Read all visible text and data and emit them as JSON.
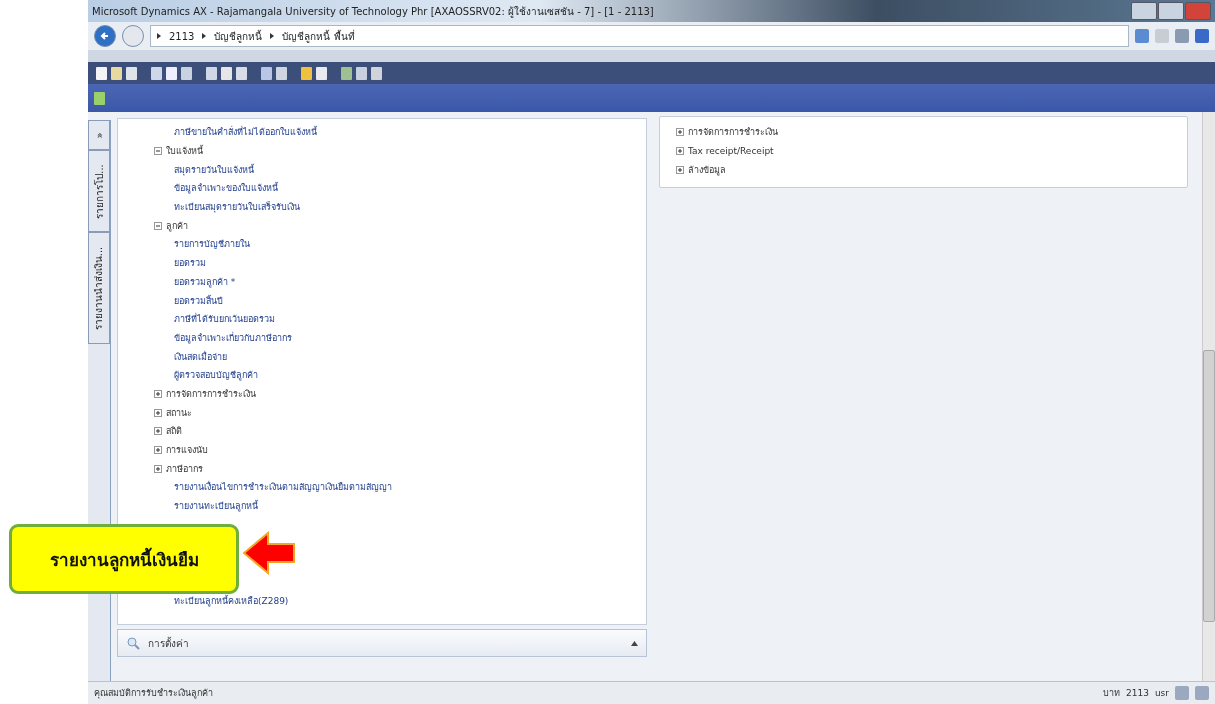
{
  "window": {
    "title": "Microsoft Dynamics AX - Rajamangala University of Technology Phr [AXAOSSRV02: ผู้ใช้งานเซสชัน - 7] - [1 - 2113]"
  },
  "address_bar": {
    "crumbs": [
      "2113",
      "บัญชีลูกหนี้",
      "บัญชีลูกหนี้ พื้นที่"
    ]
  },
  "side_tabs": [
    {
      "label": "»"
    },
    {
      "label": "รายการโป..."
    },
    {
      "label": "รายงานนำส่งเงิน..."
    }
  ],
  "tree": [
    {
      "label": "ภาษีขายในคำสั่งที่ไม่ได้ออกใบแจ้งหนี้"
    },
    {
      "label": "ใบแจ้งหนี้",
      "expanded": true,
      "children": [
        {
          "label": "สมุดรายวันใบแจ้งหนี้"
        },
        {
          "label": "ข้อมูลจำเพาะของใบแจ้งหนี้"
        },
        {
          "label": "ทะเบียนสมุดรายวันใบเสร็จรับเงิน"
        }
      ]
    },
    {
      "label": "ลูกค้า",
      "expanded": true,
      "children": [
        {
          "label": "รายการบัญชีภายใน"
        },
        {
          "label": "ยอดรวม"
        },
        {
          "label": "ยอดรวมลูกค้า *"
        },
        {
          "label": "ยอดรวมสิ้นปี"
        },
        {
          "label": "ภาษีที่ได้รับยกเว้นยอดรวม"
        },
        {
          "label": "ข้อมูลจำเพาะเกี่ยวกับภาษีอากร"
        },
        {
          "label": "เงินสดเมื่อจ่าย"
        },
        {
          "label": "ผู้ตรวจสอบบัญชีลูกค้า"
        }
      ]
    },
    {
      "label": "การจัดการการชำระเงิน",
      "expanded": false
    },
    {
      "label": "สถานะ",
      "expanded": false
    },
    {
      "label": "สถิติ",
      "expanded": false
    },
    {
      "label": "การแจงนับ",
      "expanded": false
    },
    {
      "label": "ภาษีอากร",
      "expanded": false
    },
    {
      "label": "รายงานเงื่อนไขการชำระเงินตามสัญญาเงินยืมตามสัญญา"
    },
    {
      "label": "รายงานทะเบียนลูกหนี้"
    },
    {
      "label": "ทะเบียนลูกหนี้คงเหลือ(Z289)"
    }
  ],
  "setup_panel": {
    "title": "การตั้งค่า"
  },
  "right_tree": [
    {
      "label": "การจัดการการชำระเงิน",
      "expanded": false
    },
    {
      "label": "Tax receipt/Receipt",
      "expanded": false
    },
    {
      "label": "ล้างข้อมูล",
      "expanded": false
    }
  ],
  "callout": {
    "text": "รายงานลูกหนี้เงินยืม"
  },
  "status_bar": {
    "text": "คุณสมบัติการรับชำระเงินลูกค้า",
    "fields": [
      "บาท",
      "2113",
      "usr"
    ]
  }
}
